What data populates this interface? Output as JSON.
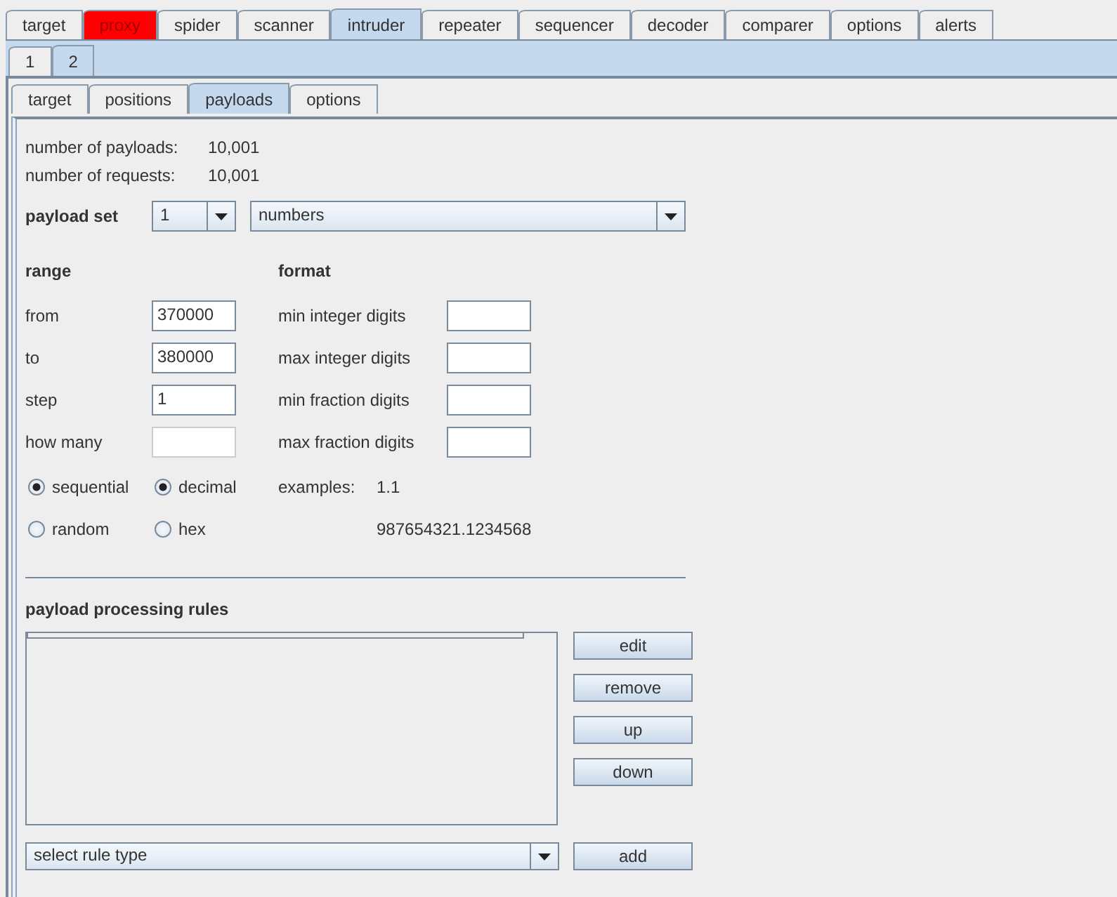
{
  "main_tabs": [
    {
      "label": "target",
      "selected": false,
      "alert": false
    },
    {
      "label": "proxy",
      "selected": false,
      "alert": true
    },
    {
      "label": "spider",
      "selected": false,
      "alert": false
    },
    {
      "label": "scanner",
      "selected": false,
      "alert": false
    },
    {
      "label": "intruder",
      "selected": true,
      "alert": false
    },
    {
      "label": "repeater",
      "selected": false,
      "alert": false
    },
    {
      "label": "sequencer",
      "selected": false,
      "alert": false
    },
    {
      "label": "decoder",
      "selected": false,
      "alert": false
    },
    {
      "label": "comparer",
      "selected": false,
      "alert": false
    },
    {
      "label": "options",
      "selected": false,
      "alert": false
    },
    {
      "label": "alerts",
      "selected": false,
      "alert": false
    }
  ],
  "attack_tabs": [
    {
      "label": "1",
      "selected": false
    },
    {
      "label": "2",
      "selected": true
    }
  ],
  "sub_tabs": [
    {
      "label": "target",
      "selected": false
    },
    {
      "label": "positions",
      "selected": false
    },
    {
      "label": "payloads",
      "selected": true
    },
    {
      "label": "options",
      "selected": false
    }
  ],
  "counts": [
    {
      "label": "number of payloads:",
      "value": "10,001"
    },
    {
      "label": "number of requests:",
      "value": "10,001"
    }
  ],
  "payload_set": {
    "label": "payload set",
    "set": "1",
    "type": "numbers"
  },
  "range": {
    "heading": "range",
    "fields": [
      {
        "label": "from",
        "value": "370000",
        "disabled": false
      },
      {
        "label": "to",
        "value": "380000",
        "disabled": false
      },
      {
        "label": "step",
        "value": "1",
        "disabled": false
      },
      {
        "label": "how many",
        "disabled": true
      }
    ]
  },
  "format": {
    "heading": "format",
    "fields": [
      {
        "label": "min integer digits"
      },
      {
        "label": "max integer digits"
      },
      {
        "label": "min fraction digits"
      },
      {
        "label": "max fraction digits"
      }
    ]
  },
  "order_options": [
    {
      "label": "sequential",
      "selected": true
    },
    {
      "label": "random",
      "selected": false
    }
  ],
  "base_options": [
    {
      "label": "decimal",
      "selected": true
    },
    {
      "label": "hex",
      "selected": false
    }
  ],
  "examples": {
    "label": "examples:",
    "values": [
      "1.1",
      "987654321.1234568"
    ]
  },
  "rules": {
    "heading": "payload processing rules",
    "buttons": [
      "edit",
      "remove",
      "up",
      "down"
    ],
    "rule_type": "select rule type",
    "add_button": "add"
  }
}
